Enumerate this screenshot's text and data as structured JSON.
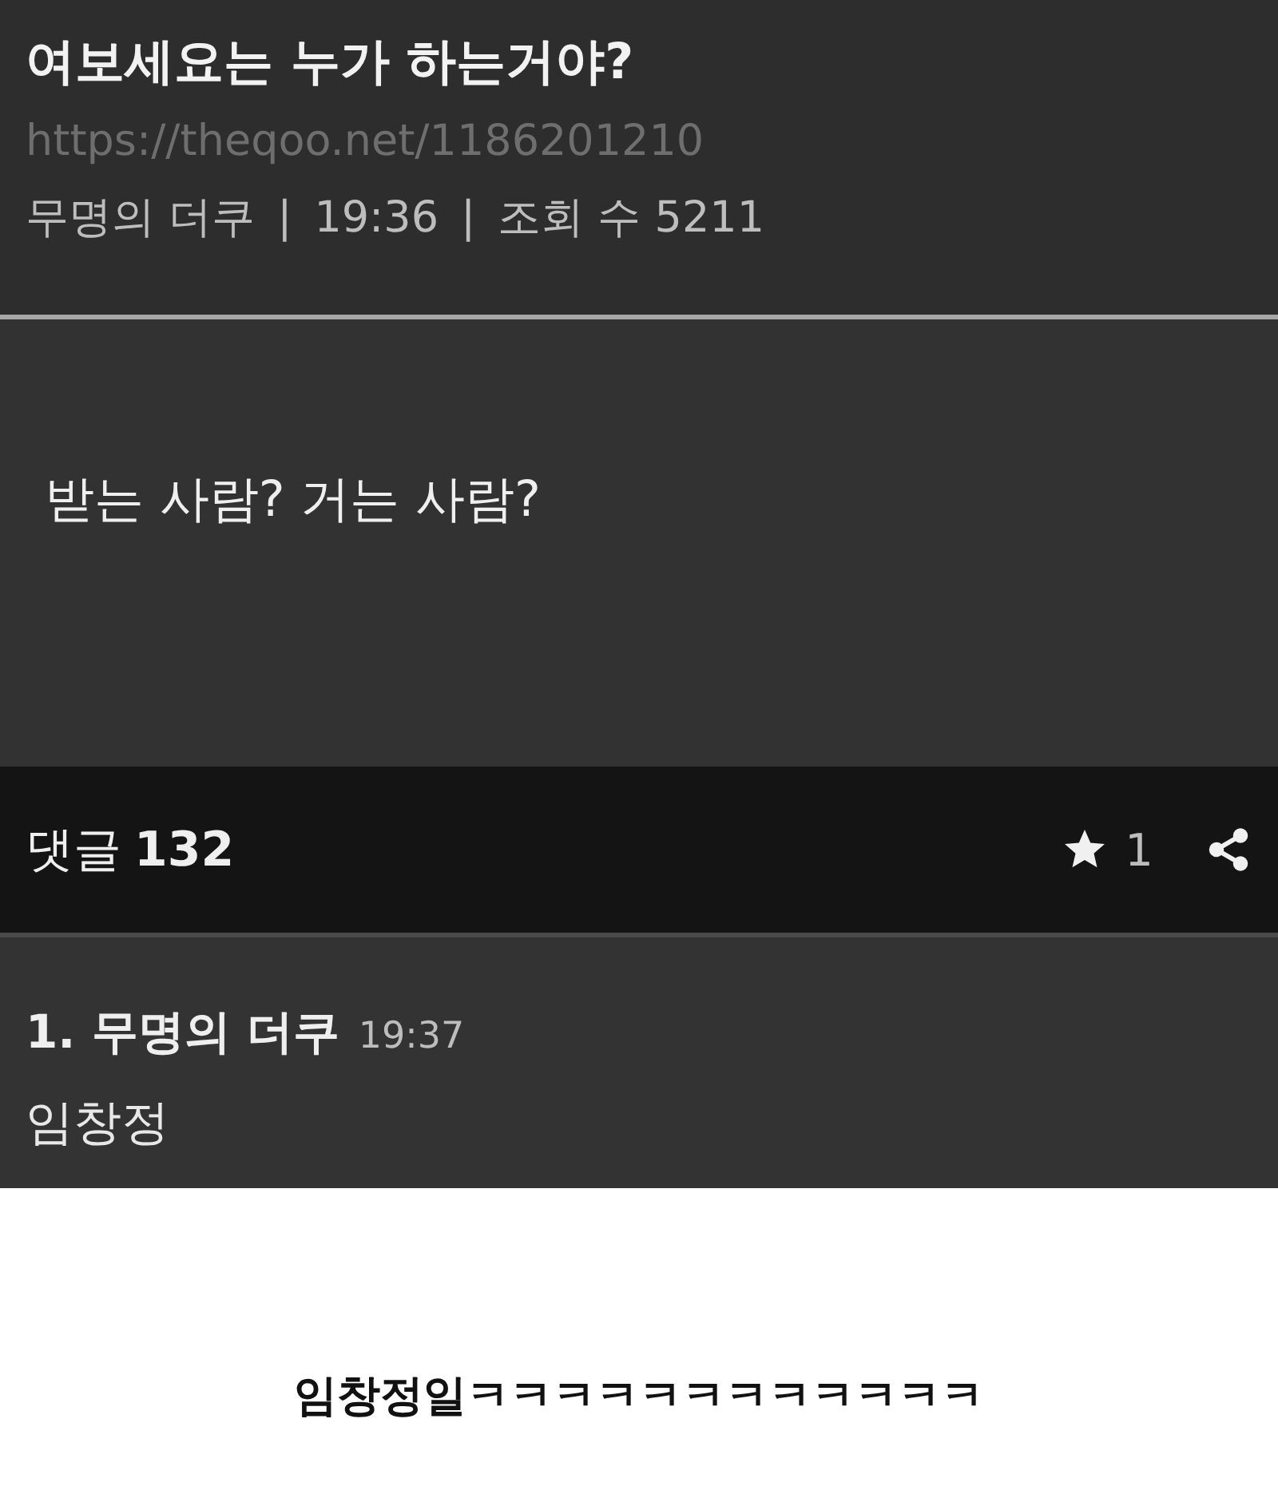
{
  "post": {
    "title": "여보세요는 누가 하는거야?",
    "url": "https://theqoo.net/1186201210",
    "meta": [
      "무명의 더쿠",
      "|",
      "19:36",
      "|",
      "조회 수 5211"
    ],
    "body": "받는 사람? 거는 사람?"
  },
  "comment_bar": {
    "label": "댓글",
    "count": "132",
    "star_count": "1"
  },
  "comments": [
    {
      "number": "1.",
      "author": "무명의 더쿠",
      "time": "19:37",
      "text": "임창정"
    }
  ],
  "caption": "임창정일ㅋㅋㅋㅋㅋㅋㅋㅋㅋㅋㅋㅋ"
}
